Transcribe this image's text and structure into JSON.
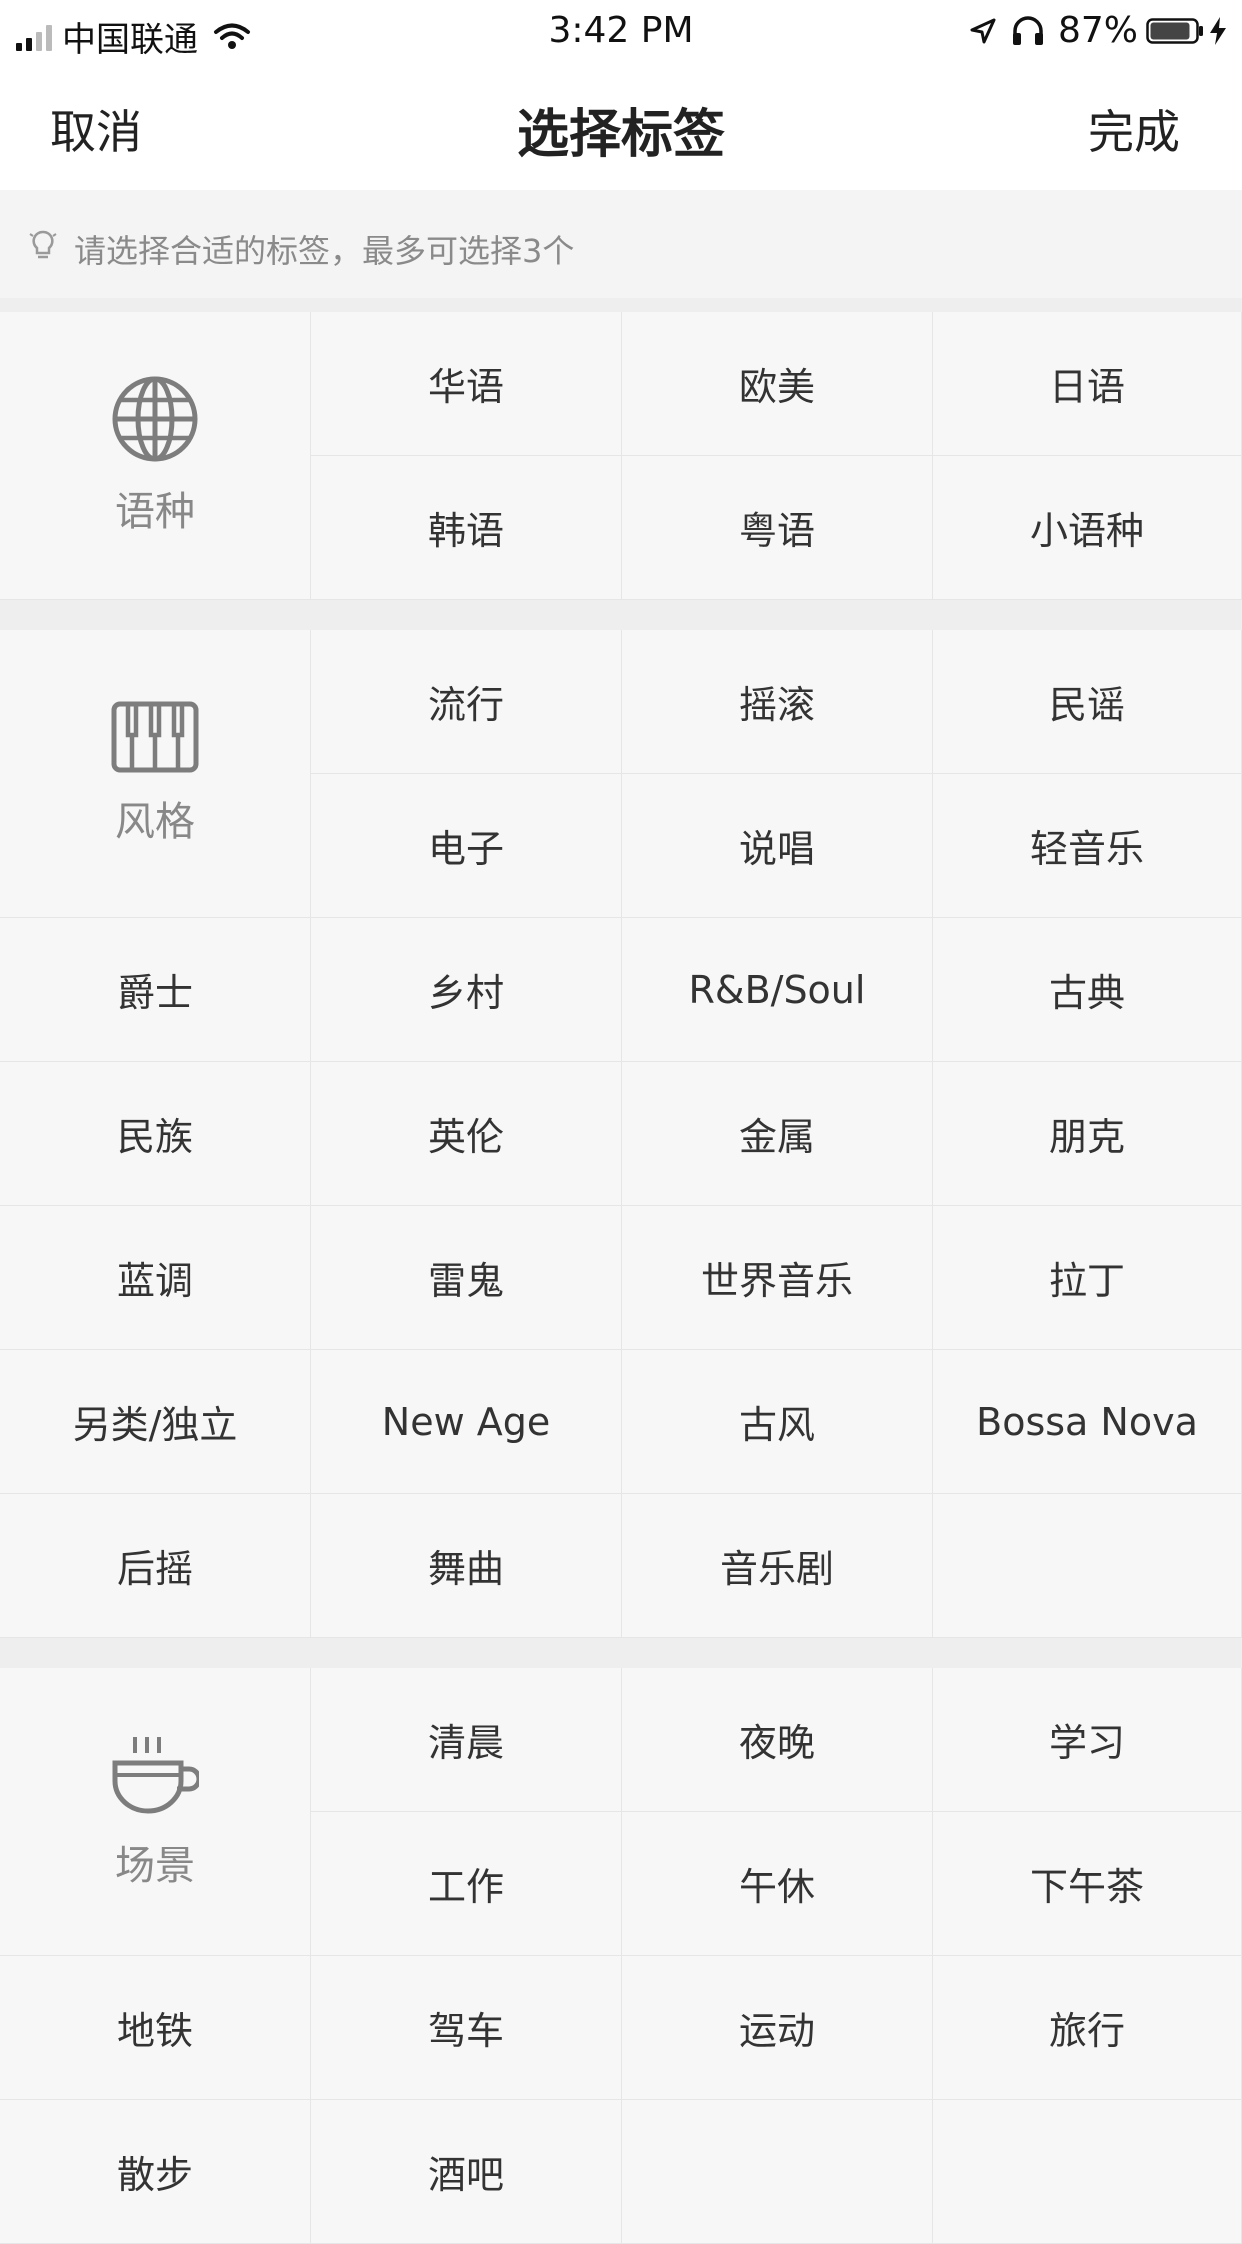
{
  "status_bar": {
    "carrier": "中国联通",
    "time": "3:42 PM",
    "battery": "87%",
    "icons": [
      "signal-icon",
      "wifi-icon",
      "location-icon",
      "headphones-icon",
      "battery-icon",
      "charging-icon"
    ]
  },
  "nav": {
    "cancel": "取消",
    "title": "选择标签",
    "done": "完成"
  },
  "hint": {
    "icon": "lightbulb-icon",
    "text": "请选择合适的标签，最多可选择3个"
  },
  "sections": [
    {
      "label": "语种",
      "icon": "globe-icon",
      "tags": [
        "华语",
        "欧美",
        "日语",
        "韩语",
        "粤语",
        "小语种"
      ]
    },
    {
      "label": "风格",
      "icon": "piano-icon",
      "tags": [
        "流行",
        "摇滚",
        "民谣",
        "电子",
        "说唱",
        "轻音乐",
        "爵士",
        "乡村",
        "R&B/Soul",
        "古典",
        "民族",
        "英伦",
        "金属",
        "朋克",
        "蓝调",
        "雷鬼",
        "世界音乐",
        "拉丁",
        "另类/独立",
        "New Age",
        "古风",
        "Bossa Nova",
        "后摇",
        "舞曲",
        "音乐剧"
      ]
    },
    {
      "label": "场景",
      "icon": "coffee-cup-icon",
      "tags": [
        "清晨",
        "夜晚",
        "学习",
        "工作",
        "午休",
        "下午茶",
        "地铁",
        "驾车",
        "运动",
        "旅行",
        "散步",
        "酒吧"
      ]
    }
  ],
  "colors": {
    "background": "#f7f7f7",
    "text": "#333333",
    "muted": "#888888",
    "divider": "#e6e6e6"
  }
}
